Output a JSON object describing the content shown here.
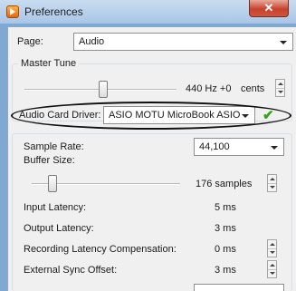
{
  "window": {
    "title": "Preferences",
    "close_label": "✕"
  },
  "page": {
    "label": "Page:",
    "selected": "Audio"
  },
  "master_tune": {
    "group_label": "Master Tune",
    "value_text": "440 Hz +0",
    "unit": "cents"
  },
  "audio_card": {
    "label": "Audio Card Driver:",
    "selected": "ASIO MOTU MicroBook ASIO",
    "status_icon": "checkmark-icon"
  },
  "settings": {
    "sample_rate_label": "Sample Rate:",
    "sample_rate_value": "44,100",
    "buffer_size_label": "Buffer Size:",
    "buffer_size_value": "176 samples",
    "input_latency_label": "Input Latency:",
    "input_latency_value": "5 ms",
    "output_latency_label": "Output Latency:",
    "output_latency_value": "3 ms",
    "recording_comp_label": "Recording Latency Compensation:",
    "recording_comp_value": "0 ms",
    "external_sync_label": "External Sync Offset:",
    "external_sync_value": "3 ms"
  },
  "colors": {
    "titlebar": "#a9c6e6",
    "close_button": "#c7432f",
    "check": "#3aa018",
    "highlight_oval": "#111111"
  }
}
